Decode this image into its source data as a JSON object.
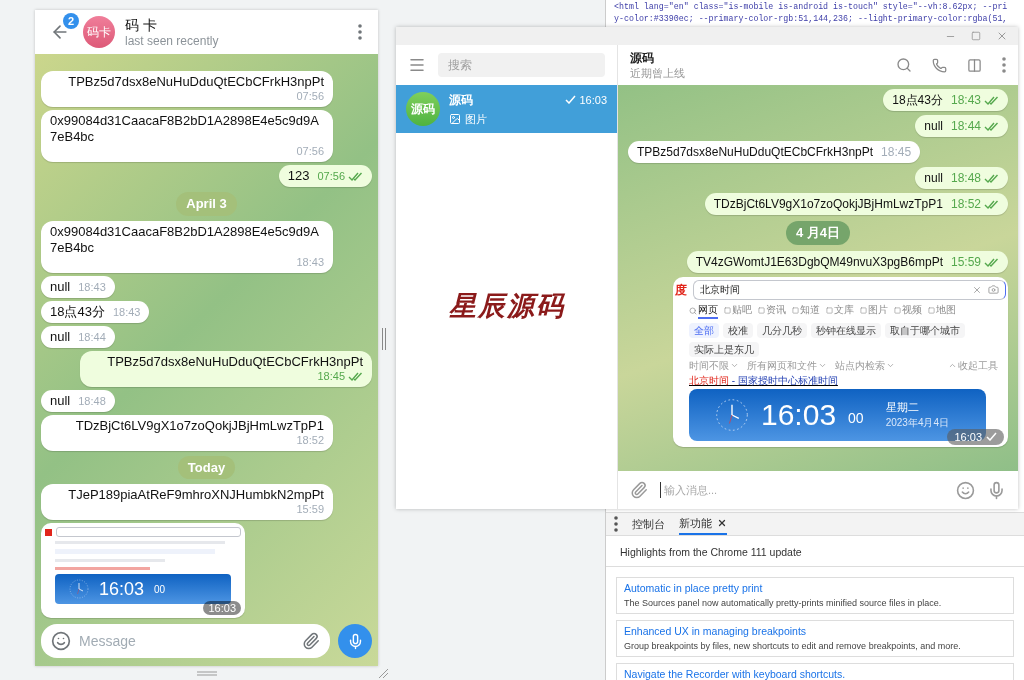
{
  "mobile_chat": {
    "back_badge": "2",
    "avatar": "码卡",
    "name": "码 卡",
    "status": "last seen recently",
    "messages": [
      {
        "kind": "text",
        "outgoing": false,
        "text": "TPBz5d7dsx8eNuHuDduQtECbCFrkH3npPt",
        "time": "07:56"
      },
      {
        "kind": "text",
        "outgoing": false,
        "text": "0x99084d31CaacaF8B2bD1A2898E4e5c9d9A7eB4bc",
        "time": "07:56"
      },
      {
        "kind": "text",
        "outgoing": true,
        "text": "123",
        "time": "07:56",
        "read": true
      },
      {
        "kind": "date",
        "text": "April 3"
      },
      {
        "kind": "text",
        "outgoing": false,
        "text": "0x99084d31CaacaF8B2bD1A2898E4e5c9d9A7eB4bc",
        "time": "18:43"
      },
      {
        "kind": "text",
        "outgoing": false,
        "text": "null",
        "time": "18:43"
      },
      {
        "kind": "text",
        "outgoing": false,
        "text": "18点43分",
        "time": "18:43"
      },
      {
        "kind": "text",
        "outgoing": false,
        "text": "null",
        "time": "18:44"
      },
      {
        "kind": "text",
        "outgoing": true,
        "text": "TPBz5d7dsx8eNuHuDduQtECbCFrkH3npPt",
        "time": "18:45",
        "read": true
      },
      {
        "kind": "text",
        "outgoing": false,
        "text": "null",
        "time": "18:48"
      },
      {
        "kind": "text",
        "outgoing": false,
        "text": "TDzBjCt6LV9gX1o7zoQokjJBjHmLwzTpP1",
        "time": "18:52"
      },
      {
        "kind": "date",
        "text": "Today"
      },
      {
        "kind": "text",
        "outgoing": false,
        "text": "TJeP189piaAtReF9mhroXNJHumbkN2mpPt",
        "time": "15:59"
      },
      {
        "kind": "image",
        "outgoing": false,
        "time": "16:03",
        "clock": "16:03",
        "seconds": "00"
      }
    ],
    "composer": {
      "placeholder": "Message"
    }
  },
  "desktop_window": {
    "sidebar": {
      "search": {
        "placeholder": "搜索"
      },
      "chats": [
        {
          "avatar": "源码",
          "name": "源码",
          "time": "16:03",
          "read": false,
          "preview": "图片",
          "selected": true
        }
      ],
      "logo": "星辰源码"
    },
    "chat": {
      "name": "源码",
      "status": "近期曾上线",
      "messages": [
        {
          "kind": "text",
          "outgoing": true,
          "text": "18点43分",
          "time": "18:43",
          "read": true
        },
        {
          "kind": "text",
          "outgoing": true,
          "text": "null",
          "time": "18:44",
          "read": true
        },
        {
          "kind": "text",
          "outgoing": false,
          "text": "TPBz5d7dsx8eNuHuDduQtECbCFrkH3npPt",
          "time": "18:45"
        },
        {
          "kind": "text",
          "outgoing": true,
          "text": "null",
          "time": "18:48",
          "read": true
        },
        {
          "kind": "text",
          "outgoing": true,
          "text": "TDzBjCt6LV9gX1o7zoQokjJBjHmLwzTpP1",
          "time": "18:52",
          "read": true
        },
        {
          "kind": "date",
          "text": "4 月4日"
        },
        {
          "kind": "text",
          "outgoing": true,
          "text": "TV4zGWomtJ1E63DgbQM49nvuX3pgB6mpPt",
          "time": "15:59",
          "read": true
        },
        {
          "kind": "screenshot",
          "outgoing": true,
          "time": "16:03",
          "read": false,
          "logo": "度",
          "query": "北京时间",
          "tabs": [
            {
              "label": "网页",
              "selected": true
            },
            {
              "label": "贴吧",
              "selected": false
            },
            {
              "label": "资讯",
              "selected": false
            },
            {
              "label": "知道",
              "selected": false
            },
            {
              "label": "文库",
              "selected": false
            },
            {
              "label": "图片",
              "selected": false
            },
            {
              "label": "视频",
              "selected": false
            },
            {
              "label": "地图",
              "selected": false
            }
          ],
          "chips": [
            {
              "label": "全部",
              "selected": true
            },
            {
              "label": "校准",
              "selected": false
            },
            {
              "label": "几分几秒",
              "selected": false
            },
            {
              "label": "秒钟在线显示",
              "selected": false
            },
            {
              "label": "取自于哪个城市",
              "selected": false
            },
            {
              "label": "实际上是东几",
              "selected": false
            }
          ],
          "filters": [
            "时间不限",
            "所有网页和文件",
            "站点内检索"
          ],
          "collapse": "收起工具",
          "result_title": {
            "highlight": "北京时间",
            "rest": " - 国家授时中心标准时间"
          },
          "clock": "16:03",
          "seconds": "00",
          "weekday": "星期二",
          "date": "2023年4月4日"
        }
      ],
      "composer": {
        "placeholder": "输入消息..."
      }
    }
  },
  "devtools": {
    "source_lines": [
      "<html lang=\"en\" class=\"is-mobile is-android is-touch\" style=\"--vh:8.62px; --pri",
      "y-color:#3390ec; --primary-color-rgb:51,144,236; --light-primary-color:rgba(51,"
    ],
    "tabs": [
      {
        "label": "控制台",
        "selected": false,
        "closable": false
      },
      {
        "label": "新功能",
        "selected": true,
        "closable": true
      }
    ],
    "heading": "Highlights from the Chrome 111 update",
    "features": [
      {
        "title": "Automatic in place pretty print",
        "description": "The Sources panel now automatically pretty-prints minified source files in place."
      },
      {
        "title": "Enhanced UX in managing breakpoints",
        "description": "Group breakpoints by files, new shortcuts to edit and remove breakpoints, and more."
      },
      {
        "title": "Navigate the Recorder with keyboard shortcuts."
      }
    ]
  }
}
